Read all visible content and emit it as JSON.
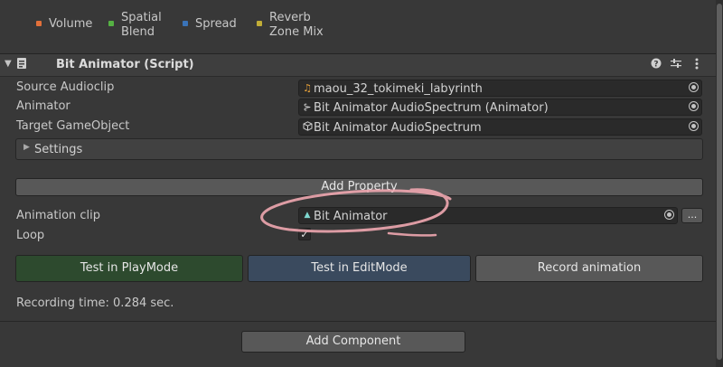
{
  "legend": {
    "items": [
      {
        "label_line1": "Volume",
        "label_line2": "",
        "color": "#e2703a"
      },
      {
        "label_line1": "Spatial",
        "label_line2": "Blend",
        "color": "#55b143"
      },
      {
        "label_line1": "Spread",
        "label_line2": "",
        "color": "#3a73b8"
      },
      {
        "label_line1": "Reverb",
        "label_line2": "Zone Mix",
        "color": "#c1ad37"
      }
    ]
  },
  "component": {
    "title": "Bit Animator (Script)",
    "source_audioclip": {
      "label": "Source Audioclip",
      "value": "maou_32_tokimeki_labyrinth",
      "icon": "audio-clip-icon"
    },
    "animator": {
      "label": "Animator",
      "value": "Bit Animator AudioSpectrum (Animator)",
      "icon": "animator-icon"
    },
    "target_gameobject": {
      "label": "Target GameObject",
      "value": "Bit Animator AudioSpectrum",
      "icon": "gameobject-icon"
    },
    "settings_label": "Settings",
    "add_property_label": "Add Property",
    "animation_clip": {
      "label": "Animation clip",
      "value": "Bit Animator",
      "icon": "animation-clip-icon"
    },
    "more_label": "...",
    "loop": {
      "label": "Loop",
      "checked": true,
      "check_glyph": "✓"
    },
    "buttons": {
      "test_playmode": "Test in PlayMode",
      "test_editmode": "Test in EditMode",
      "record": "Record animation"
    },
    "recording_time": "Recording time: 0.284 sec."
  },
  "add_component_label": "Add Component",
  "colors": {
    "play_button": "#2d4a2e",
    "edit_button": "#3a4a5e",
    "annotation": "#f0a7b0"
  }
}
